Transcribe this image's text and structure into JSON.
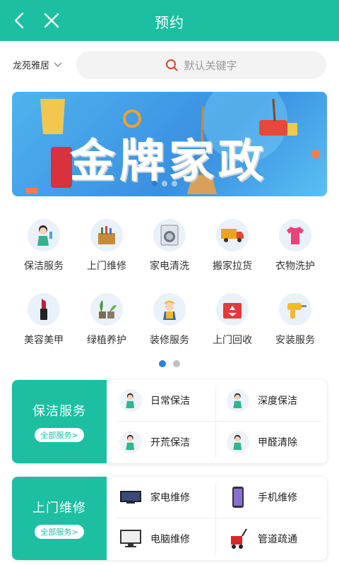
{
  "header": {
    "title": "预约"
  },
  "location": {
    "name": "龙苑雅居"
  },
  "search": {
    "placeholder": "默认关键字"
  },
  "banner": {
    "text": "金牌家政"
  },
  "categories": [
    {
      "label": "保洁服务",
      "icon": "cleaner-woman-icon"
    },
    {
      "label": "上门维修",
      "icon": "toolbox-icon"
    },
    {
      "label": "家电清洗",
      "icon": "washing-machine-icon"
    },
    {
      "label": "搬家拉货",
      "icon": "truck-icon"
    },
    {
      "label": "衣物洗护",
      "icon": "tshirt-icon"
    },
    {
      "label": "美容美甲",
      "icon": "lipstick-icon"
    },
    {
      "label": "绿植养护",
      "icon": "plants-icon"
    },
    {
      "label": "装修服务",
      "icon": "worker-icon"
    },
    {
      "label": "上门回收",
      "icon": "recycle-box-icon"
    },
    {
      "label": "安装服务",
      "icon": "drill-icon"
    }
  ],
  "sections": [
    {
      "title": "保洁服务",
      "all_label": "全部服务>",
      "items": [
        {
          "label": "日常保洁",
          "icon": "cleaner-woman-icon"
        },
        {
          "label": "深度保洁",
          "icon": "cleaner-woman-icon"
        },
        {
          "label": "开荒保洁",
          "icon": "cleaner-woman-icon"
        },
        {
          "label": "甲醛清除",
          "icon": "cleaner-woman-icon"
        }
      ]
    },
    {
      "title": "上门维修",
      "all_label": "全部服务>",
      "items": [
        {
          "label": "家电维修",
          "icon": "tv-icon"
        },
        {
          "label": "手机维修",
          "icon": "phone-icon"
        },
        {
          "label": "电脑维修",
          "icon": "computer-icon"
        },
        {
          "label": "管道疏通",
          "icon": "plunger-icon"
        }
      ]
    }
  ],
  "colors": {
    "accent": "#1cbfa2",
    "dot_active": "#2b83d6"
  }
}
